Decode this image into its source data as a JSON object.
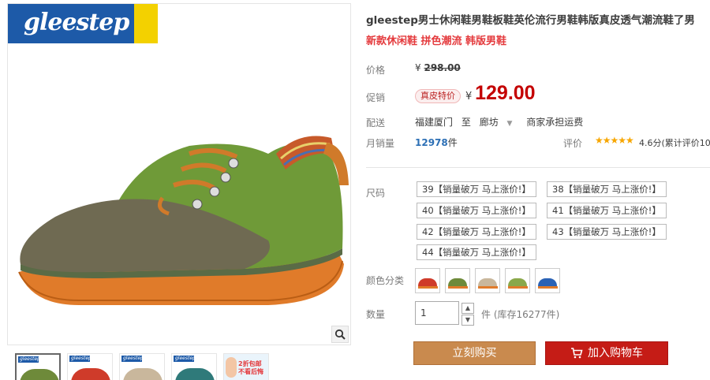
{
  "gallery": {
    "brand_logo": "gleestep",
    "zoom_icon": "magnifier-icon",
    "thumbnails": [
      {
        "logo": "gleestep",
        "color": "#6e8a3a"
      },
      {
        "logo": "gleestep",
        "color": "#cf3b2a"
      },
      {
        "logo": "gleestep",
        "color": "#c9b79c"
      },
      {
        "logo": "gleestep",
        "color": "#2f7a7a"
      },
      {
        "promo": "2折包邮 不看后悔"
      }
    ]
  },
  "product": {
    "title": "gleestep男士休闲鞋男鞋板鞋英伦流行男鞋韩版真皮透气潮流鞋了男",
    "subtitle": "新款休闲鞋 拼色潮流 韩版男鞋"
  },
  "price": {
    "label": "价格",
    "currency": "¥",
    "original": "298.00"
  },
  "promo": {
    "label": "促销",
    "badge": "真皮特价",
    "currency": "¥",
    "price": "129.00"
  },
  "shipping": {
    "label": "配送",
    "from": "福建厦门",
    "to_word": "至",
    "to": "廊坊",
    "fee": "商家承担运费"
  },
  "sales": {
    "label": "月销量",
    "count": "12978",
    "unit": "件"
  },
  "rating": {
    "label": "评价",
    "stars": "★★★★★",
    "text": "4.6分(累计评价10"
  },
  "sizes": {
    "label": "尺码",
    "options": [
      "39【销量破万 马上涨价!】",
      "38【销量破万 马上涨价!】",
      "40【销量破万 马上涨价!】",
      "41【销量破万 马上涨价!】",
      "42【销量破万 马上涨价!】",
      "43【销量破万 马上涨价!】",
      "44【销量破万 马上涨价!】"
    ]
  },
  "colors": {
    "label": "颜色分类",
    "swatches": [
      "#cf3b2a",
      "#6e8a3a",
      "#c9b79c",
      "#8aa84a",
      "#2a62b5"
    ]
  },
  "quantity": {
    "label": "数量",
    "value": "1",
    "up": "▲",
    "down": "▼",
    "stock": "件 (库存16277件)"
  },
  "actions": {
    "buy_now": "立刻购买",
    "add_to_cart": "加入购物车"
  }
}
